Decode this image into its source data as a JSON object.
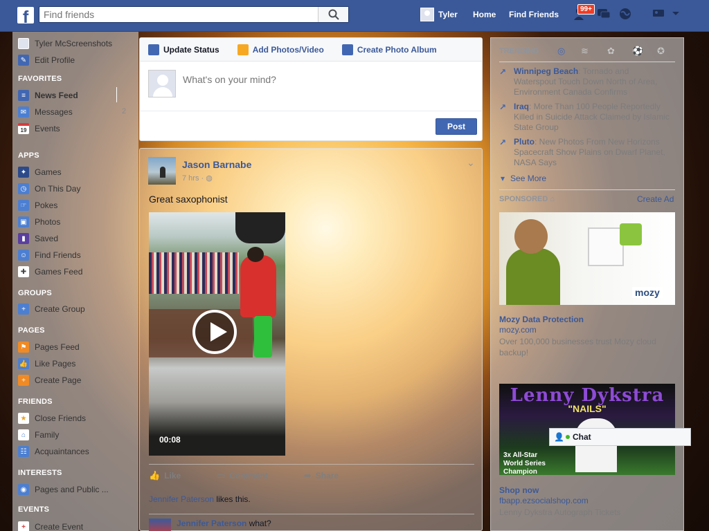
{
  "topbar": {
    "logo": "f",
    "search_placeholder": "Find friends",
    "user_name": "Tyler",
    "home": "Home",
    "find_friends": "Find Friends",
    "friend_requests_badge": "99+"
  },
  "leftnav": {
    "profile_name": "Tyler McScreenshots",
    "edit_profile": "Edit Profile",
    "favorites_header": "FAVORITES",
    "news_feed": "News Feed",
    "messages": "Messages",
    "messages_count": "2",
    "events": "Events",
    "calendar_day": "19",
    "apps_header": "APPS",
    "games": "Games",
    "on_this_day": "On This Day",
    "pokes": "Pokes",
    "photos": "Photos",
    "saved": "Saved",
    "find_friends": "Find Friends",
    "games_feed": "Games Feed",
    "groups_header": "GROUPS",
    "create_group": "Create Group",
    "pages_header": "PAGES",
    "pages_feed": "Pages Feed",
    "like_pages": "Like Pages",
    "create_page": "Create Page",
    "friends_header": "FRIENDS",
    "close_friends": "Close Friends",
    "family": "Family",
    "acquaintances": "Acquaintances",
    "interests_header": "INTERESTS",
    "pages_and_public": "Pages and Public ...",
    "events_header": "EVENTS",
    "create_event": "Create Event"
  },
  "composer": {
    "update_status": "Update Status",
    "add_photos": "Add Photos/Video",
    "create_album": "Create Photo Album",
    "placeholder": "What's on your mind?",
    "post_button": "Post"
  },
  "post": {
    "author": "Jason Barnabe",
    "time": "7 hrs · ",
    "text": "Great saxophonist",
    "video_duration": "00:08",
    "like": "Like",
    "comment": "Comment",
    "share": "Share",
    "liker": "Jennifer Paterson",
    "likes_suffix": " likes this.",
    "comment_author": "Jennifer Paterson",
    "comment_text": " what?"
  },
  "trending": {
    "header": "TRENDING",
    "items": [
      {
        "name": "Winnipeg Beach",
        "text": ": Tornado and Waterspout Touch Down North of Area, Environment Canada Confirms"
      },
      {
        "name": "Iraq",
        "text": ": More Than 100 People Reportedly Killed in Suicide Attack Claimed by Islamic State Group"
      },
      {
        "name": "Pluto",
        "text": ": New Photos From New Horizons Spacecraft Show Plains on Dwarf Planet, NASA Says"
      }
    ],
    "see_more": "See More"
  },
  "sponsored": {
    "header": "SPONSORED",
    "create_ad": "Create Ad",
    "ad1": {
      "logo_text": "mozy",
      "title": "Mozy Data Protection",
      "domain": "mozy.com",
      "body": "Over 100,000 businesses trust Mozy cloud backup!"
    },
    "ad2": {
      "banner": "Lenny Dykstra",
      "banner_sub": "\"NAILS\"",
      "banner_caption": "3x All-Star World Series Champion",
      "title": "Shop now",
      "domain": "fbapp.ezsocialshop.com",
      "body": "Lenny Dykstra Autograph Tickets"
    }
  },
  "chat": {
    "label": "Chat"
  },
  "colors": {
    "brand": "#3b5998",
    "button": "#4267b2",
    "badge": "#f03d25"
  }
}
